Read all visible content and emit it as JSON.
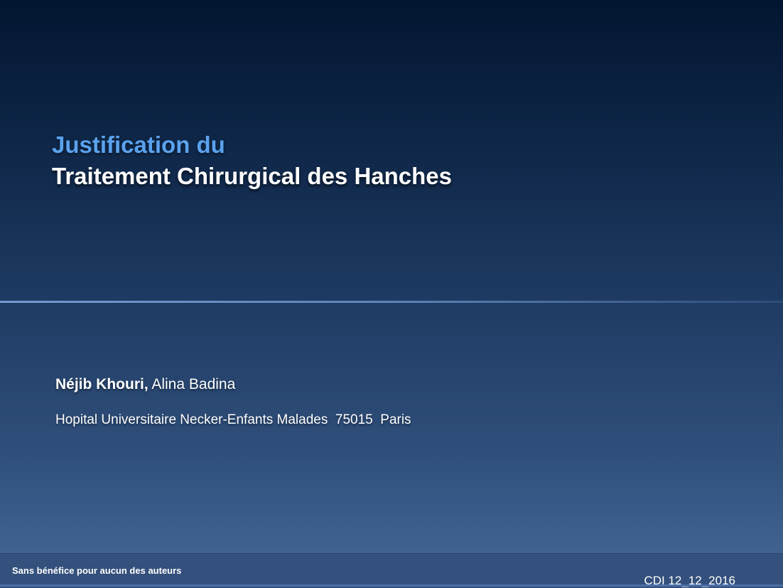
{
  "slide": {
    "title_line1": "Justification du",
    "title_line2": "Traitement Chirurgical des Hanches",
    "authors": {
      "lead": "Néjib Khouri,",
      "others": " Alina Badina"
    },
    "affiliation": "Hopital Universitaire Necker-Enfants Malades  75015  Paris"
  },
  "footer": {
    "disclaimer": "Sans bénéfice pour aucun des auteurs",
    "date_label": "CDI 12_12_2016"
  },
  "colors": {
    "title_accent": "#5aa2ee",
    "background_top": "#021631",
    "background_bottom": "#4468a0",
    "footer_band": "#34507c"
  }
}
